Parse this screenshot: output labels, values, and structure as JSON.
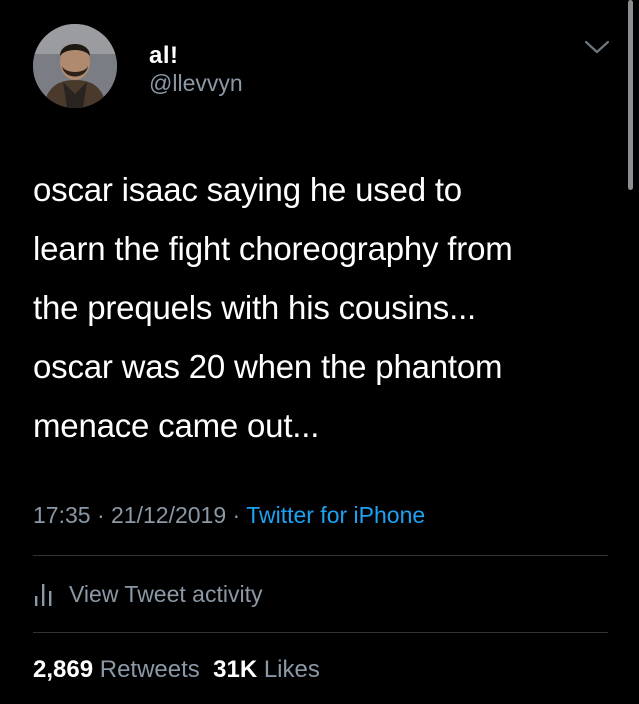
{
  "author": {
    "display_name": "a‌l!",
    "handle": "@llevvyn",
    "avatar": "avatar-photo"
  },
  "icons": {
    "menu": "chevron-down-icon",
    "activity": "bar-chart-icon"
  },
  "tweet": {
    "text_lines": [
      "oscar isaac saying he used to",
      "learn the fight choreography from",
      "the prequels with his cousins...",
      "oscar was 20 when the phantom",
      "menace came out..."
    ]
  },
  "meta": {
    "time": "17:35",
    "separator": "·",
    "date": "21/12/2019",
    "source": "Twitter for iPhone"
  },
  "activity": {
    "label": "View Tweet activity"
  },
  "stats": {
    "retweets_count": "2,869",
    "retweets_label": "Retweets",
    "likes_count": "31K",
    "likes_label": "Likes"
  },
  "colors": {
    "background": "#000000",
    "text": "#ffffff",
    "secondary": "#8b98a5",
    "link": "#1da1f2",
    "divider": "#2f3336"
  }
}
